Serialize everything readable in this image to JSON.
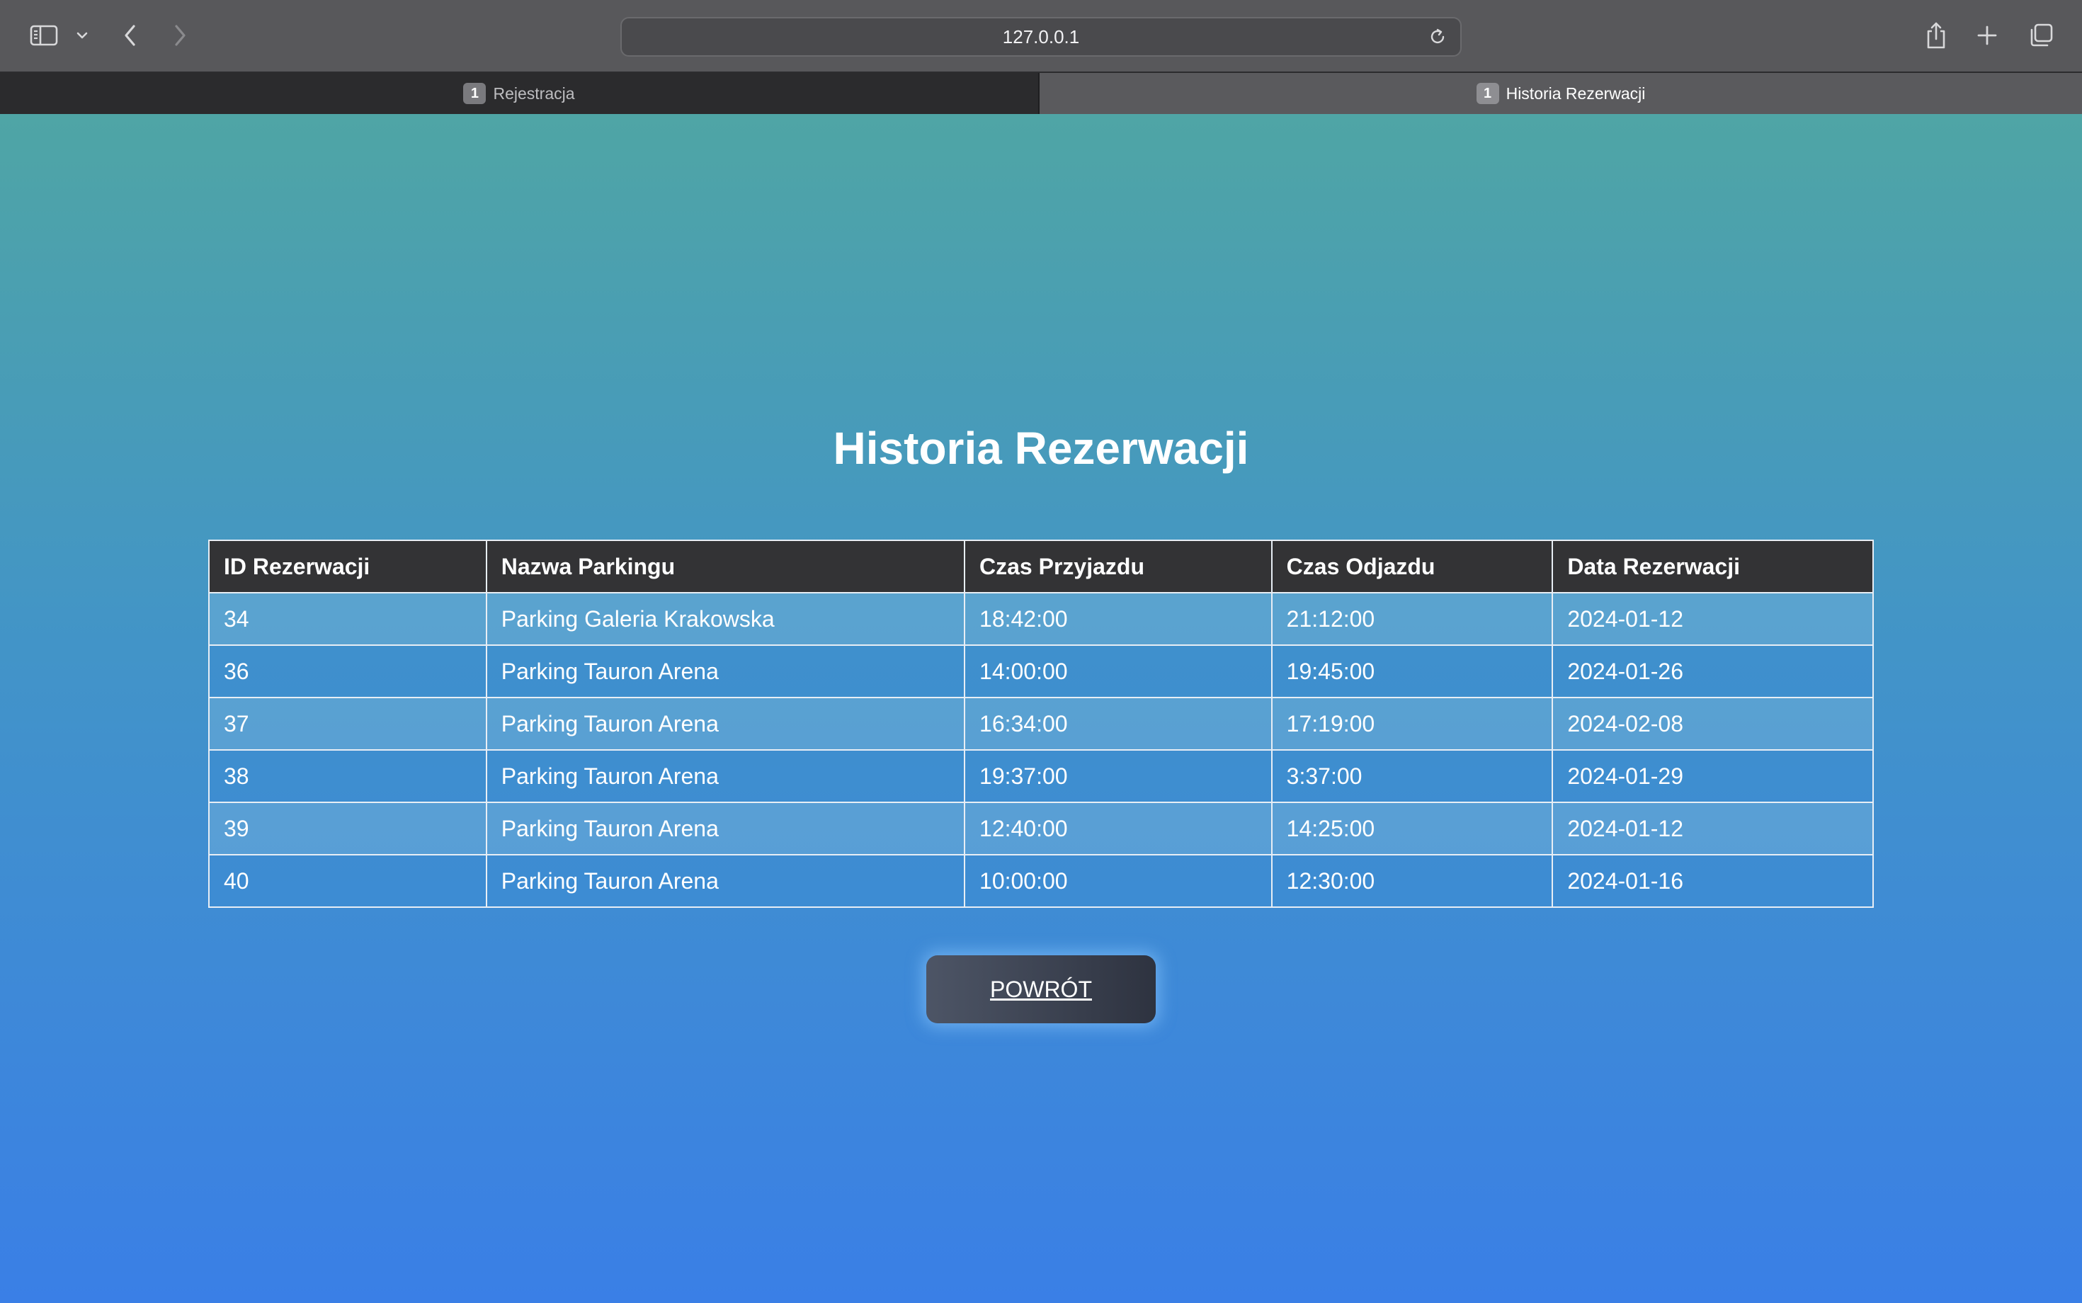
{
  "browser": {
    "address": "127.0.0.1",
    "tabs": [
      {
        "badge": "1",
        "label": "Rejestracja"
      },
      {
        "badge": "1",
        "label": "Historia Rezerwacji"
      }
    ],
    "icons": {
      "sidebar_toggle": "sidebar-icon",
      "sidebar_chevron": "chevron-down-icon",
      "back": "chevron-left-icon",
      "forward": "chevron-right-icon",
      "reload": "reload-icon",
      "share": "share-icon",
      "new_tab": "plus-icon",
      "tab_overview": "tabs-overview-icon"
    }
  },
  "page": {
    "title": "Historia Rezerwacji",
    "table": {
      "headers": [
        "ID Rezerwacji",
        "Nazwa Parkingu",
        "Czas Przyjazdu",
        "Czas Odjazdu",
        "Data Rezerwacji"
      ],
      "rows": [
        [
          "34",
          "Parking Galeria Krakowska",
          "18:42:00",
          "21:12:00",
          "2024-01-12"
        ],
        [
          "36",
          "Parking Tauron Arena",
          "14:00:00",
          "19:45:00",
          "2024-01-26"
        ],
        [
          "37",
          "Parking Tauron Arena",
          "16:34:00",
          "17:19:00",
          "2024-02-08"
        ],
        [
          "38",
          "Parking Tauron Arena",
          "19:37:00",
          "3:37:00",
          "2024-01-29"
        ],
        [
          "39",
          "Parking Tauron Arena",
          "12:40:00",
          "14:25:00",
          "2024-01-12"
        ],
        [
          "40",
          "Parking Tauron Arena",
          "10:00:00",
          "12:30:00",
          "2024-01-16"
        ]
      ]
    },
    "back_button": "POWRÓT"
  },
  "colors": {
    "gradient_top": "#4fa5a5",
    "gradient_bottom": "#3a7fe6",
    "table_header": "#333335",
    "button": "#3a4150"
  }
}
